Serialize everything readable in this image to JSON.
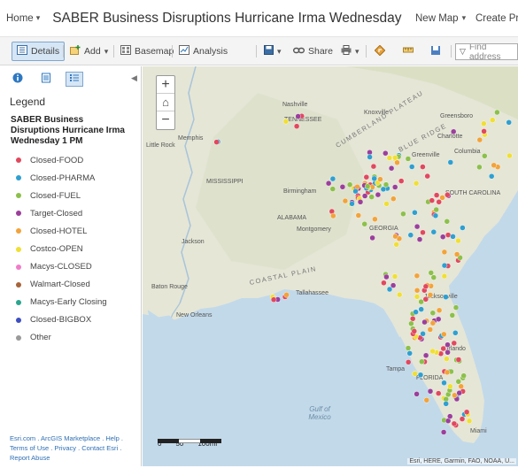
{
  "header": {
    "home_label": "Home",
    "title": "SABER Business Disruptions Hurricane Irma Wednesday",
    "new_map_label": "New Map",
    "create_label": "Create Pre"
  },
  "toolbar": {
    "details_label": "Details",
    "add_label": "Add",
    "basemap_label": "Basemap",
    "analysis_label": "Analysis",
    "share_label": "Share",
    "find_placeholder": "Find address"
  },
  "legend": {
    "heading": "Legend",
    "layer_title": "SABER Business Disruptions Hurricane Irma Wednesday 1 PM",
    "items": [
      {
        "label": "Closed-FOOD",
        "color": "#e1485e"
      },
      {
        "label": "Closed-PHARMA",
        "color": "#2f9fd0"
      },
      {
        "label": "Closed-FUEL",
        "color": "#8cc04b"
      },
      {
        "label": "Target-Closed",
        "color": "#9b3f9b"
      },
      {
        "label": "Closed-HOTEL",
        "color": "#f2a33a"
      },
      {
        "label": "Costco-OPEN",
        "color": "#f0df35"
      },
      {
        "label": "Macys-CLOSED",
        "color": "#f07cc8"
      },
      {
        "label": "Walmart-Closed",
        "color": "#a7643a"
      },
      {
        "label": "Macys-Early Closing",
        "color": "#2ba58d"
      },
      {
        "label": "Closed-BIGBOX",
        "color": "#3d4fc0"
      },
      {
        "label": "Other",
        "color": "#9a9a9a"
      }
    ],
    "footer_line1": "Esri.com . ArcGIS Marketplace . Help .",
    "footer_line2": "Terms of Use . Privacy . Contact Esri .",
    "footer_line3": "Report Abuse"
  },
  "map": {
    "zoom_in": "+",
    "home": "⌂",
    "zoom_out": "−",
    "attribution": "Esri, HERE, Garmin, FAO, NOAA, U...",
    "scale_labels": [
      "0",
      "50",
      "100mi"
    ],
    "place_labels": [
      "Nashville",
      "TENNESSEE",
      "Knoxville",
      "Greensboro",
      "Charlotte",
      "Greenville",
      "Columbia",
      "SOUTH CAROLINA",
      "Memphis",
      "Little Rock",
      "MISSISSIPPI",
      "Birmingham",
      "ALABAMA",
      "Montgomery",
      "GEORGIA",
      "Jackson",
      "Baton Rouge",
      "New Orleans",
      "Tallahassee",
      "Jacksonville",
      "Tampa",
      "FLORIDA",
      "Orlando",
      "Miami",
      "CUMBERLAND PLATEAU",
      "BLUE RIDGE",
      "COASTAL PLAIN",
      "Gulf of Mexico"
    ]
  }
}
